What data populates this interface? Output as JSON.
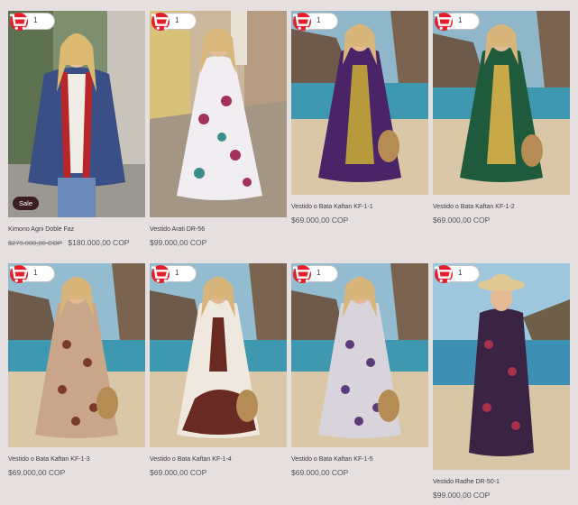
{
  "cart": {
    "quantity": "1"
  },
  "badges": {
    "sale": "Sale"
  },
  "products": [
    {
      "name": "Kimono Agni Doble Faz",
      "old_price": "$279.000,00 COP",
      "price": "$180.000,00 COP",
      "on_sale": true
    },
    {
      "name": "Vestido Arati DR-56",
      "price": "$99.000,00 COP"
    },
    {
      "name": "Vestido o Bata Kaftan KF-1-1",
      "price": "$69.000,00 COP"
    },
    {
      "name": "Vestido o Bata Kaftan KF-1-2",
      "price": "$69.000,00 COP"
    },
    {
      "name": "Vestido o Bata Kaftan KF-1-3",
      "price": "$69.000,00 COP"
    },
    {
      "name": "Vestido o Bata Kaftan KF-1-4",
      "price": "$69.000,00 COP"
    },
    {
      "name": "Vestido o Bata Kaftan KF-1-5",
      "price": "$69.000,00 COP"
    },
    {
      "name": "Vestido Radhe DR-50-1",
      "price": "$99.000,00 COP"
    }
  ],
  "colors": {
    "background": "#e6dfe0",
    "cart_button": "#e2202c",
    "sale_badge": "#3b1f22"
  }
}
